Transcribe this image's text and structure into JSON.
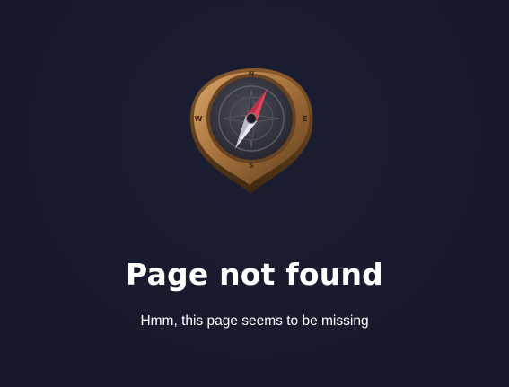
{
  "page": {
    "title": "Page not found",
    "message": "Hmm, this page seems to be missing"
  },
  "illustration": {
    "icon": "compass-icon",
    "directions": {
      "north": "N",
      "east": "E",
      "south": "S",
      "west": "W"
    }
  },
  "colors": {
    "background": "#181a2e",
    "text": "#ffffff",
    "compass_rim": "#a8743e",
    "compass_needle_north": "#e0455a",
    "compass_needle_south": "#e8e8f0"
  }
}
